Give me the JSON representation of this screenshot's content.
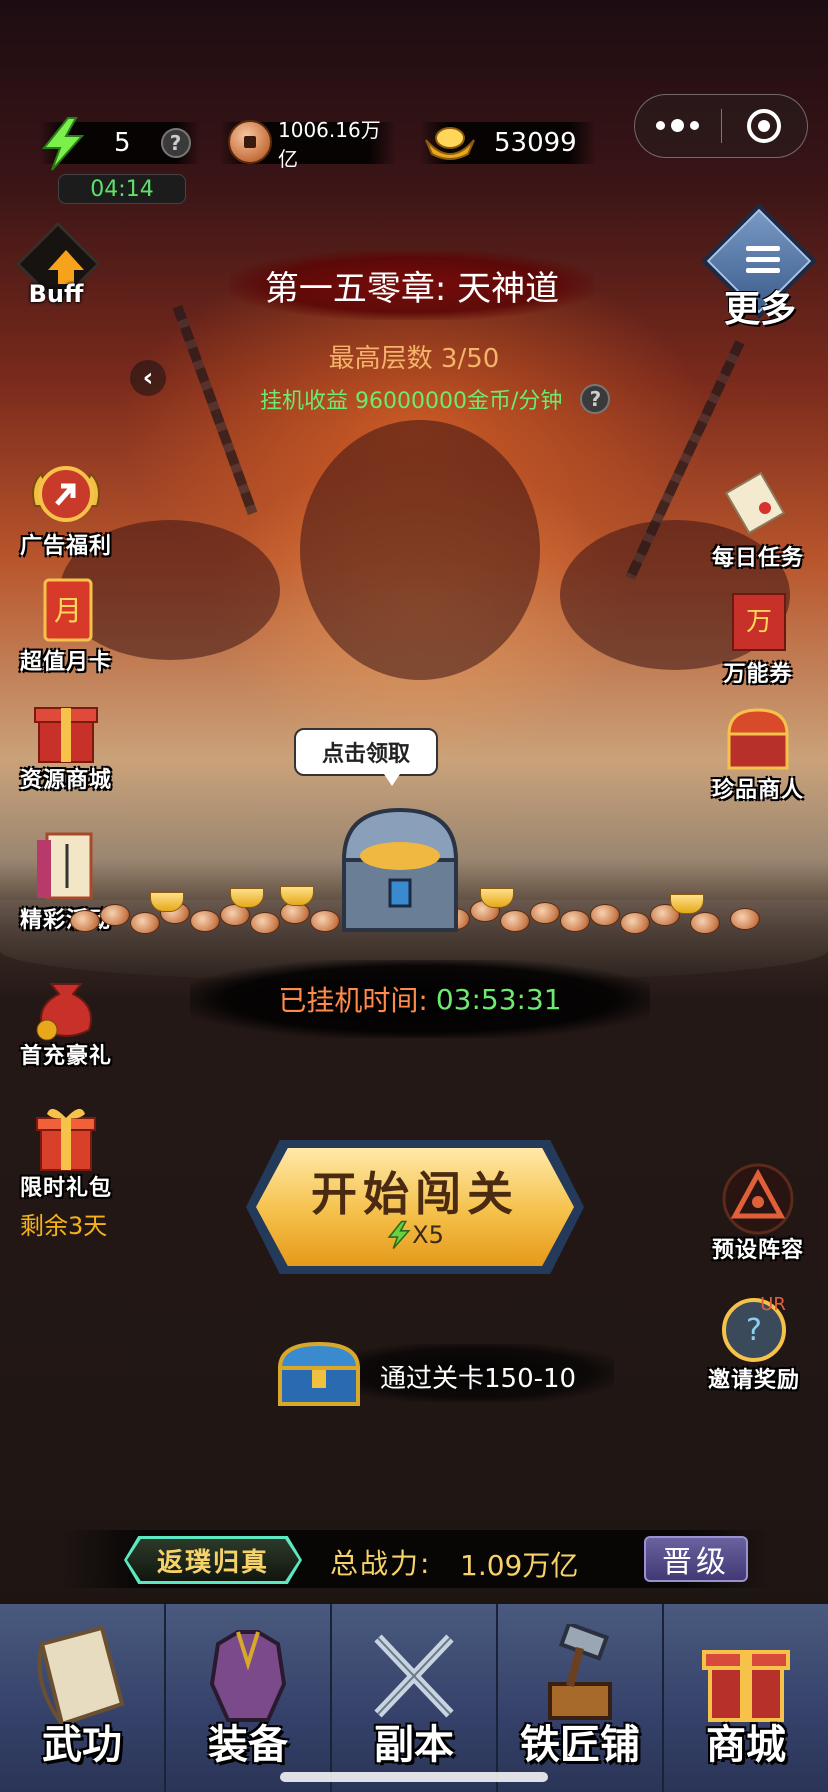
{
  "status": {
    "energy": "5",
    "energy_timer": "04:14",
    "copper": "1006.16万亿",
    "gold": "53099"
  },
  "header": {
    "buff_label": "Buff",
    "chapter_title": "第一五零章: 天神道",
    "more_label": "更多",
    "max_floor": "最高层数 3/50",
    "idle_income": "挂机收益 96000000金币/分钟"
  },
  "left_menu": [
    {
      "label": "广告福利"
    },
    {
      "label": "超值月卡"
    },
    {
      "label": "资源商城"
    },
    {
      "label": "精彩活动"
    },
    {
      "label": "首充豪礼"
    },
    {
      "label": "限时礼包",
      "sub": "剩余3天"
    }
  ],
  "right_menu": [
    {
      "label": "每日任务"
    },
    {
      "label": "万能券"
    },
    {
      "label": "珍品商人"
    },
    {
      "label": "预设阵容"
    },
    {
      "label": "邀请奖励"
    }
  ],
  "chest_bubble": "点击领取",
  "idle_time": {
    "label": "已挂机时间:",
    "value": "03:53:31"
  },
  "start_button": {
    "label": "开始闯关",
    "cost": "X5"
  },
  "pass_reward": "通过关卡150-10",
  "power_bar": {
    "rank": "返璞归真",
    "label": "总战力:",
    "value": "1.09万亿",
    "upgrade": "晋级"
  },
  "nav": [
    {
      "label": "武功"
    },
    {
      "label": "装备"
    },
    {
      "label": "副本"
    },
    {
      "label": "铁匠铺"
    },
    {
      "label": "商城"
    }
  ],
  "icons": {
    "energy": "lightning-icon",
    "copper": "copper-coin-icon",
    "gold": "gold-ingot-icon",
    "help": "question-icon"
  },
  "colors": {
    "energy_green": "#5fe06a",
    "income_green": "#6eea6e",
    "floor_orange": "#f4b36a",
    "button_gold": "#f5c04a"
  }
}
